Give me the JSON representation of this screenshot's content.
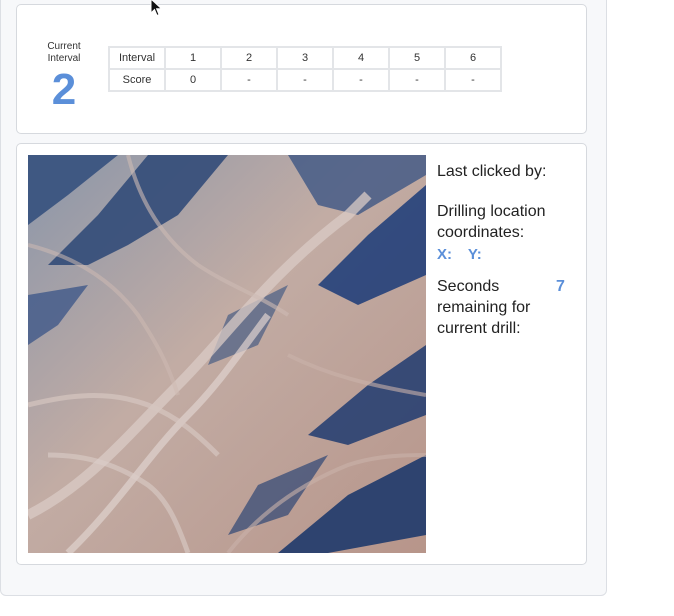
{
  "current_interval": {
    "label": "Current Interval",
    "value": "2"
  },
  "score_table": {
    "row_headers": [
      "Interval",
      "Score"
    ],
    "intervals": [
      "1",
      "2",
      "3",
      "4",
      "5",
      "6"
    ],
    "scores": [
      "0",
      "-",
      "-",
      "-",
      "-",
      "-"
    ]
  },
  "info": {
    "last_clicked_label": "Last clicked by:",
    "drilling_label": "Drilling location coordinates:",
    "x_label": "X:",
    "y_label": "Y:",
    "seconds_label": "Seconds remaining for current drill:",
    "seconds_value": "7"
  },
  "colors": {
    "accent": "#5b8fd9",
    "terrain_shadow": "#1f3a6b",
    "terrain_ridge": "#c9b3aa"
  },
  "icons": {
    "cursor": "mouse-pointer-icon"
  }
}
